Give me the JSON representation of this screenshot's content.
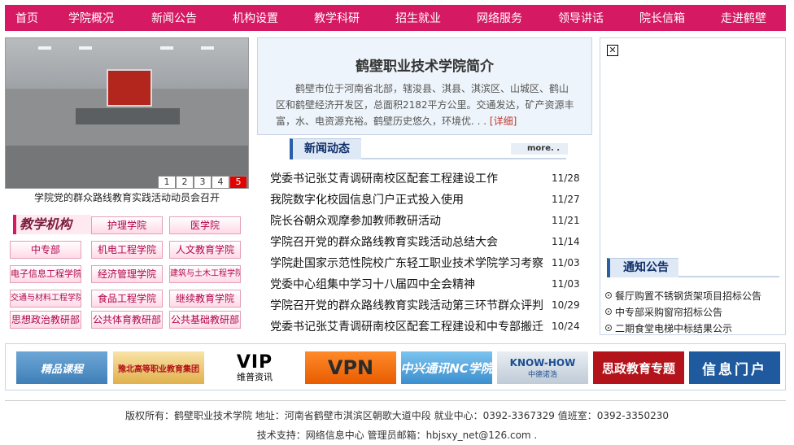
{
  "nav": {
    "items": [
      "首页",
      "学院概况",
      "新闻公告",
      "机构设置",
      "教学科研",
      "招生就业",
      "网络服务",
      "领导讲话",
      "院长信箱",
      "走进鹤壁"
    ]
  },
  "slideshow": {
    "numbers": [
      "1",
      "2",
      "3",
      "4",
      "5"
    ],
    "active_index": 5,
    "caption": "学院党的群众路线教育实践活动动员会召开"
  },
  "departments": {
    "title": "教学机构",
    "items": [
      "护理学院",
      "医学院",
      "中专部",
      "机电工程学院",
      "人文教育学院",
      "电子信息工程学院",
      "经济管理学院",
      "建筑与土木工程学院",
      "交通与材料工程学院",
      "食品工程学院",
      "继续教育学院",
      "思想政治教研部",
      "公共体育教研部",
      "公共基础教研部"
    ]
  },
  "intro": {
    "title": "鹤壁职业技术学院简介",
    "text": "鹤壁市位于河南省北部，辖浚县、淇县、淇滨区、山城区、鹤山区和鹤壁经济开发区，总面积2182平方公里。交通发达，矿产资源丰富，水、电资源充裕。鹤壁历史悠久，环境优. . .",
    "more": "[详细]"
  },
  "news": {
    "tab": "新闻动态",
    "more": "more. .",
    "items": [
      {
        "title": "党委书记张艾青调研南校区配套工程建设工作",
        "date": "11/28"
      },
      {
        "title": "我院数字化校园信息门户正式投入使用",
        "date": "11/27"
      },
      {
        "title": "院长谷朝众观摩参加教师教研活动",
        "date": "11/21"
      },
      {
        "title": "学院召开党的群众路线教育实践活动总结大会",
        "date": "11/14"
      },
      {
        "title": "学院赴国家示范性院校广东轻工职业技术学院学习考察",
        "date": "11/03"
      },
      {
        "title": "党委中心组集中学习十八届四中全会精神",
        "date": "11/03"
      },
      {
        "title": "学院召开党的群众路线教育实践活动第三环节群众评判",
        "date": "10/29"
      },
      {
        "title": "党委书记张艾青调研南校区配套工程建设和中专部搬迁",
        "date": "10/24"
      }
    ]
  },
  "right": {
    "broken_image_glyph": "✕",
    "notice_tab": "通知公告",
    "notices": [
      "餐厅购置不锈钢货架项目招标公告",
      "中专部采购窗帘招标公告",
      "二期食堂电梯中标结果公示"
    ]
  },
  "banners": {
    "b1": "精品课程",
    "b2": "豫北高等职业教育集团",
    "b3_big": "VIP",
    "b3_small": "维普资讯",
    "b4": "VPN",
    "b5": "中兴通讯NC学院",
    "b6_big": "KNOW-HOW",
    "b6_small": "中德诺浩",
    "b7": "思政教育专题",
    "b8": "信息门户"
  },
  "footer": {
    "line1": "版权所有：鹤壁职业技术学院  地址：河南省鹤壁市淇滨区朝歌大道中段  就业中心：0392-3367329  值班室：0392-3350230",
    "line2": "技术支持：网络信息中心  管理员邮箱：hbjsxy_net@126.com ."
  },
  "colors": {
    "nav_bg": "#d51a63",
    "accent_blue": "#2a5ea8",
    "dept_text": "#b1064d",
    "active_slide": "#e30000"
  }
}
